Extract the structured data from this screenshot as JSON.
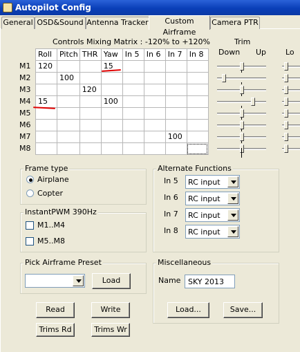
{
  "window": {
    "title": "Autopilot Config"
  },
  "tabs": [
    {
      "label": "General"
    },
    {
      "label": "OSD&Sound"
    },
    {
      "label": "Antenna Tracker"
    },
    {
      "label": "Custom Airframe"
    },
    {
      "label": "Camera PTR"
    }
  ],
  "matrix": {
    "title": "Controls Mixing Matrix : -120% to +120%",
    "columns": [
      "Roll",
      "Pitch",
      "THR",
      "Yaw",
      "In 5",
      "In 6",
      "In 7",
      "In 8"
    ],
    "rows": [
      {
        "label": "M1",
        "cells": [
          "120",
          "",
          "",
          "15",
          "",
          "",
          "",
          ""
        ]
      },
      {
        "label": "M2",
        "cells": [
          "",
          "100",
          "",
          "",
          "",
          "",
          "",
          ""
        ]
      },
      {
        "label": "M3",
        "cells": [
          "",
          "",
          "120",
          "",
          "",
          "",
          "",
          ""
        ]
      },
      {
        "label": "M4",
        "cells": [
          "15",
          "",
          "",
          "100",
          "",
          "",
          "",
          ""
        ]
      },
      {
        "label": "M5",
        "cells": [
          "",
          "",
          "",
          "",
          "",
          "",
          "",
          ""
        ]
      },
      {
        "label": "M6",
        "cells": [
          "",
          "",
          "",
          "",
          "",
          "",
          "",
          ""
        ]
      },
      {
        "label": "M7",
        "cells": [
          "",
          "",
          "",
          "",
          "",
          "",
          "100",
          ""
        ]
      },
      {
        "label": "M8",
        "cells": [
          "",
          "",
          "",
          "",
          "",
          "",
          "",
          ""
        ]
      }
    ]
  },
  "trim": {
    "title": "Trim",
    "down": "Down",
    "up": "Up",
    "lo": "Lo",
    "positions": [
      0.5,
      0.1,
      0.5,
      0.75,
      0.5,
      0.5,
      0.5,
      0.5
    ]
  },
  "frame_type": {
    "title": "Frame type",
    "options": [
      "Airplane",
      "Copter"
    ],
    "selected": "Airplane"
  },
  "instant_pwm": {
    "title": "InstantPWM 390Hz",
    "options": [
      "M1..M4",
      "M5..M8"
    ]
  },
  "alternate": {
    "title": "Alternate Functions",
    "rows": [
      {
        "label": "In 5",
        "value": "RC input"
      },
      {
        "label": "In 6",
        "value": "RC input"
      },
      {
        "label": "In 7",
        "value": "RC input"
      },
      {
        "label": "In 8",
        "value": "RC input"
      }
    ]
  },
  "preset": {
    "title": "Pick Airframe Preset",
    "value": "",
    "load": "Load"
  },
  "misc": {
    "title": "Miscellaneous",
    "name_label": "Name",
    "name_value": "SKY 2013",
    "load": "Load...",
    "save": "Save..."
  },
  "buttons": {
    "read": "Read",
    "write": "Write",
    "trims_rd": "Trims Rd",
    "trims_wr": "Trims Wr"
  }
}
